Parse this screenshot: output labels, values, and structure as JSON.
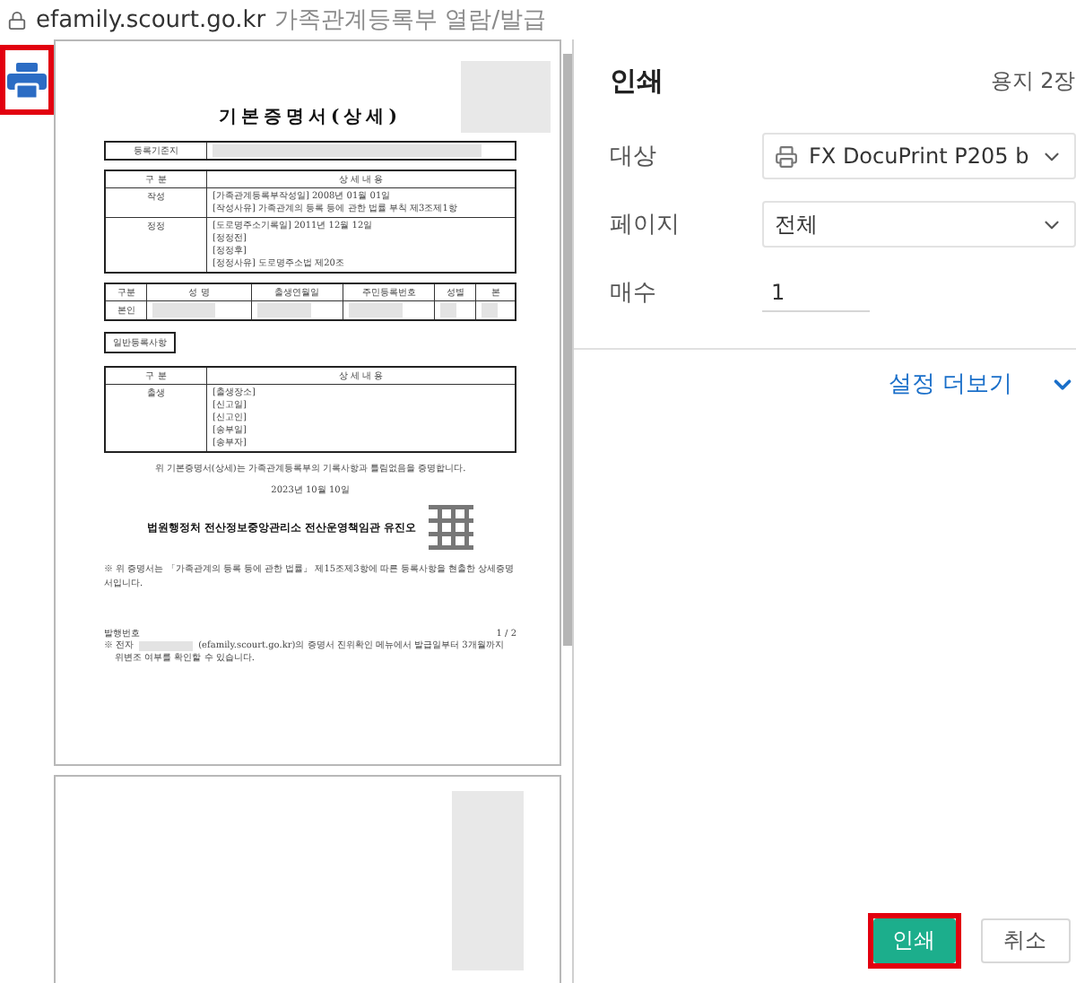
{
  "address_bar": {
    "domain": "efamily.scourt.go.kr",
    "page_title": "가족관계등록부 열람/발급"
  },
  "side_toolbar": {
    "print_shortcut": {
      "highlighted": true
    }
  },
  "document": {
    "title": "기본증명서(상세)",
    "registration_base": {
      "label": "등록기준지"
    },
    "history_table": {
      "columns": [
        "구 분",
        "상 세 내 용"
      ],
      "rows": [
        {
          "category": "작성",
          "lines": [
            "[가족관계등록부작성일]   2008년 01월 01일",
            "[작성사유]   가족관계의 등록 등에 관한 법률 부칙 제3조제1항"
          ]
        },
        {
          "category": "정정",
          "lines": [
            "[도로명주소기록일]   2011년 12월 12일",
            "[정정전]",
            "[정정후]",
            "[정정사유]   도로명주소법 제20조"
          ]
        }
      ]
    },
    "person_table": {
      "columns": [
        "구분",
        "성 명",
        "출생연월일",
        "주민등록번호",
        "성별",
        "본"
      ],
      "rows": [
        {
          "category": "본인"
        }
      ]
    },
    "general_section": "일반등록사항",
    "event_table": {
      "columns": [
        "구 분",
        "상 세 내 용"
      ],
      "rows": [
        {
          "category": "출생",
          "lines": [
            "[출생장소]",
            "[신고일]",
            "[신고인]",
            "[송부일]",
            "[송부자]"
          ]
        }
      ]
    },
    "certification": "위 기본증명서(상세)는 가족관계등록부의 기록사항과 틀림없음을 증명합니다.",
    "date": "2023년 10월 10일",
    "issuer": "법원행정처 전산정보중앙관리소 전산운영책임관 유진오",
    "note": "※ 위 증명서는 「가족관계의 등록 등에 관한 법률」 제15조제3항에 따른 등록사항을 현출한 상세증명서입니다.",
    "issue_number_label": "발행번호",
    "page_number": "1 / 2",
    "footer_start": "※ 전자",
    "footer_rest": "(efamily.scourt.go.kr)의 증명서 진위확인 메뉴에서 발급일부터 3개월까지",
    "footer_line2": "위변조 여부를 확인할 수 있습니다."
  },
  "print_panel": {
    "title": "인쇄",
    "sheet_count": "용지 2장",
    "settings": [
      {
        "kind": "printer",
        "label": "대상",
        "value": "FX DocuPrint P205 b"
      },
      {
        "kind": "select",
        "label": "페이지",
        "value": "전체"
      },
      {
        "kind": "number",
        "label": "매수",
        "value": "1"
      }
    ],
    "more_settings": {
      "label": "설정 더보기",
      "expanded": false
    },
    "buttons": [
      {
        "kind": "primary",
        "label": "인쇄",
        "highlighted": true
      },
      {
        "kind": "secondary",
        "label": "취소",
        "highlighted": false
      }
    ]
  }
}
